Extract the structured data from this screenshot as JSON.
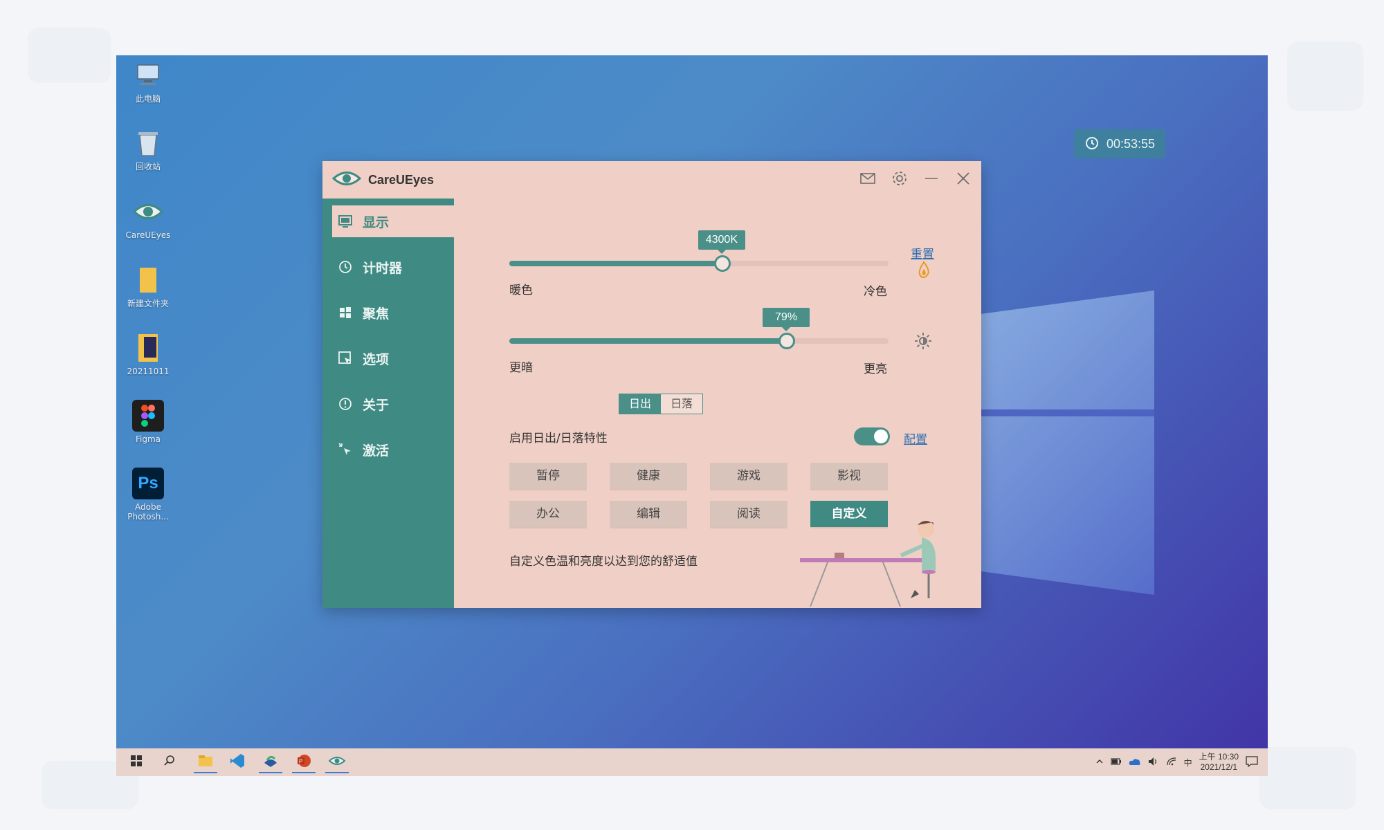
{
  "desktop": {
    "icons": [
      {
        "label": "此电脑",
        "icon": "computer-icon"
      },
      {
        "label": "回收站",
        "icon": "recycle-bin-icon"
      },
      {
        "label": "CareUEyes",
        "icon": "careueyes-icon"
      },
      {
        "label": "新建文件夹",
        "icon": "folder-icon"
      },
      {
        "label": "20211011",
        "icon": "folder-image-icon"
      },
      {
        "label": "Figma",
        "icon": "figma-icon"
      },
      {
        "label": "Adobe Photosh...",
        "icon": "photoshop-icon"
      }
    ],
    "timer_badge": "00:53:55"
  },
  "app": {
    "title": "CareUEyes",
    "sidebar": [
      {
        "label": "显示",
        "icon": "monitor-icon",
        "active": true
      },
      {
        "label": "计时器",
        "icon": "clock-icon",
        "active": false
      },
      {
        "label": "聚焦",
        "icon": "windows-icon",
        "active": false
      },
      {
        "label": "选项",
        "icon": "cursor-icon",
        "active": false
      },
      {
        "label": "关于",
        "icon": "info-icon",
        "active": false
      },
      {
        "label": "激活",
        "icon": "activate-icon",
        "active": false
      }
    ],
    "color_temp": {
      "value_label": "4300K",
      "percent": 56,
      "left": "暖色",
      "right": "冷色"
    },
    "reset_link": "重置",
    "brightness": {
      "value_label": "79%",
      "percent": 73,
      "left": "更暗",
      "right": "更亮"
    },
    "sun_toggle": {
      "sunrise": "日出",
      "sunset": "日落",
      "selected": "日出"
    },
    "sun_feature": {
      "label": "启用日出/日落特性",
      "enabled": true,
      "config_link": "配置"
    },
    "modes": [
      {
        "label": "暂停",
        "active": false
      },
      {
        "label": "健康",
        "active": false
      },
      {
        "label": "游戏",
        "active": false
      },
      {
        "label": "影视",
        "active": false
      },
      {
        "label": "办公",
        "active": false
      },
      {
        "label": "编辑",
        "active": false
      },
      {
        "label": "阅读",
        "active": false
      },
      {
        "label": "自定义",
        "active": true
      }
    ],
    "description": "自定义色温和亮度以达到您的舒适值"
  },
  "taskbar": {
    "apps": [
      "start-icon",
      "search-icon",
      "file-explorer-icon",
      "vscode-icon",
      "app-icon",
      "powerpoint-icon",
      "careueyes-icon"
    ],
    "tray": {
      "lang": "中",
      "time": "上午 10:30",
      "date": "2021/12/1"
    }
  },
  "colors": {
    "accent": "#3f8a83",
    "window_bg": "#f0d0c6",
    "link": "#2c6cb0"
  }
}
